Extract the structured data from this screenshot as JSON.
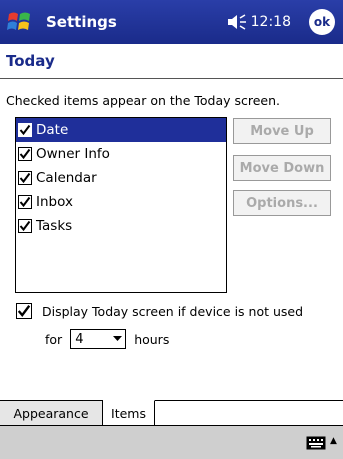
{
  "titlebar": {
    "app_title": "Settings",
    "clock": "12:18",
    "ok_label": "ok"
  },
  "page": {
    "title": "Today",
    "instructions": "Checked items appear on the Today screen."
  },
  "list": {
    "items": [
      {
        "label": "Date",
        "checked": true,
        "selected": true
      },
      {
        "label": "Owner Info",
        "checked": true,
        "selected": false
      },
      {
        "label": "Calendar",
        "checked": true,
        "selected": false
      },
      {
        "label": "Inbox",
        "checked": true,
        "selected": false
      },
      {
        "label": "Tasks",
        "checked": true,
        "selected": false
      }
    ]
  },
  "buttons": {
    "move_up": "Move Up",
    "move_down": "Move Down",
    "options": "Options..."
  },
  "display_option": {
    "label": "Display Today screen if device is not used",
    "checked": true,
    "for_label": "for",
    "hours_value": "4",
    "hours_label": "hours"
  },
  "tabs": [
    {
      "label": "Appearance"
    },
    {
      "label": "Items"
    }
  ],
  "colors": {
    "titlebar": "#1a2b8a",
    "selection": "#1f2f9a",
    "disabled_text": "#aaaaaa"
  }
}
